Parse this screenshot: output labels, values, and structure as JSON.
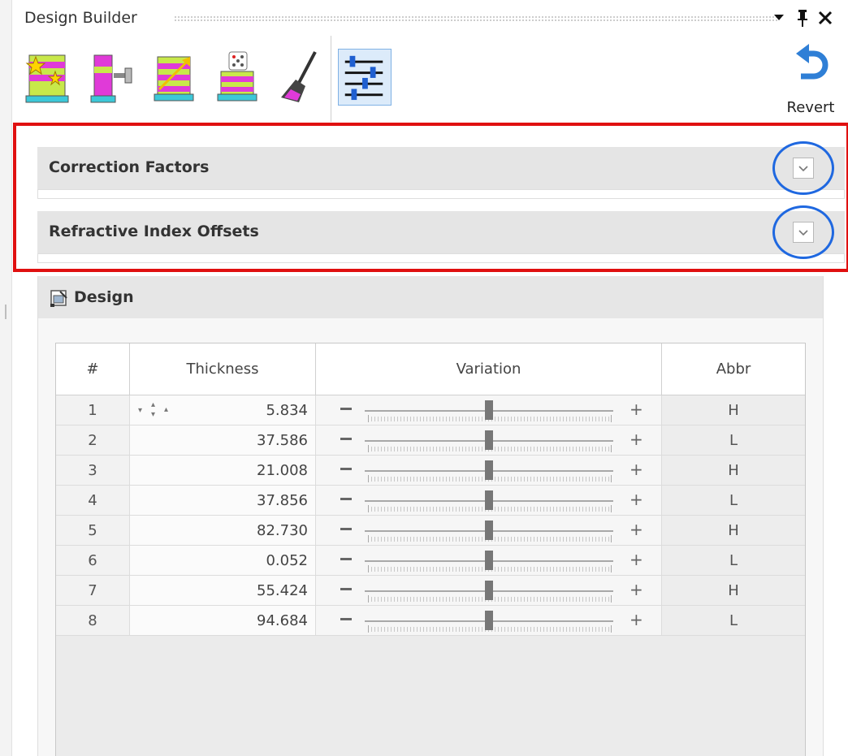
{
  "window": {
    "title": "Design Builder",
    "icons": [
      "dropdown-arrow-icon",
      "pin-icon",
      "close-icon"
    ]
  },
  "toolbar": {
    "tools": [
      "design-wizard-icon",
      "layer-edit-icon",
      "optimize-icon",
      "random-icon",
      "cleanup-broom-icon",
      "sliders-icon"
    ],
    "active_tool": "sliders-icon",
    "revert_label": "Revert"
  },
  "sections": [
    {
      "title": "Correction Factors"
    },
    {
      "title": "Refractive Index Offsets"
    }
  ],
  "design": {
    "title": "Design",
    "columns": [
      "#",
      "Thickness",
      "Variation",
      "Abbr"
    ],
    "rows": [
      {
        "num": "1",
        "thickness": "5.834",
        "abbr": "H",
        "variation": 0.5
      },
      {
        "num": "2",
        "thickness": "37.586",
        "abbr": "L",
        "variation": 0.5
      },
      {
        "num": "3",
        "thickness": "21.008",
        "abbr": "H",
        "variation": 0.5
      },
      {
        "num": "4",
        "thickness": "37.856",
        "abbr": "L",
        "variation": 0.5
      },
      {
        "num": "5",
        "thickness": "82.730",
        "abbr": "H",
        "variation": 0.5
      },
      {
        "num": "6",
        "thickness": "0.052",
        "abbr": "L",
        "variation": 0.5
      },
      {
        "num": "7",
        "thickness": "55.424",
        "abbr": "H",
        "variation": 0.5
      },
      {
        "num": "8",
        "thickness": "94.684",
        "abbr": "L",
        "variation": 0.5
      }
    ]
  },
  "colors": {
    "highlight_box": "#e01010",
    "highlight_ring": "#1f68e0",
    "active_tool_bg": "#dcebfa",
    "revert_icon": "#2f7fd6"
  }
}
